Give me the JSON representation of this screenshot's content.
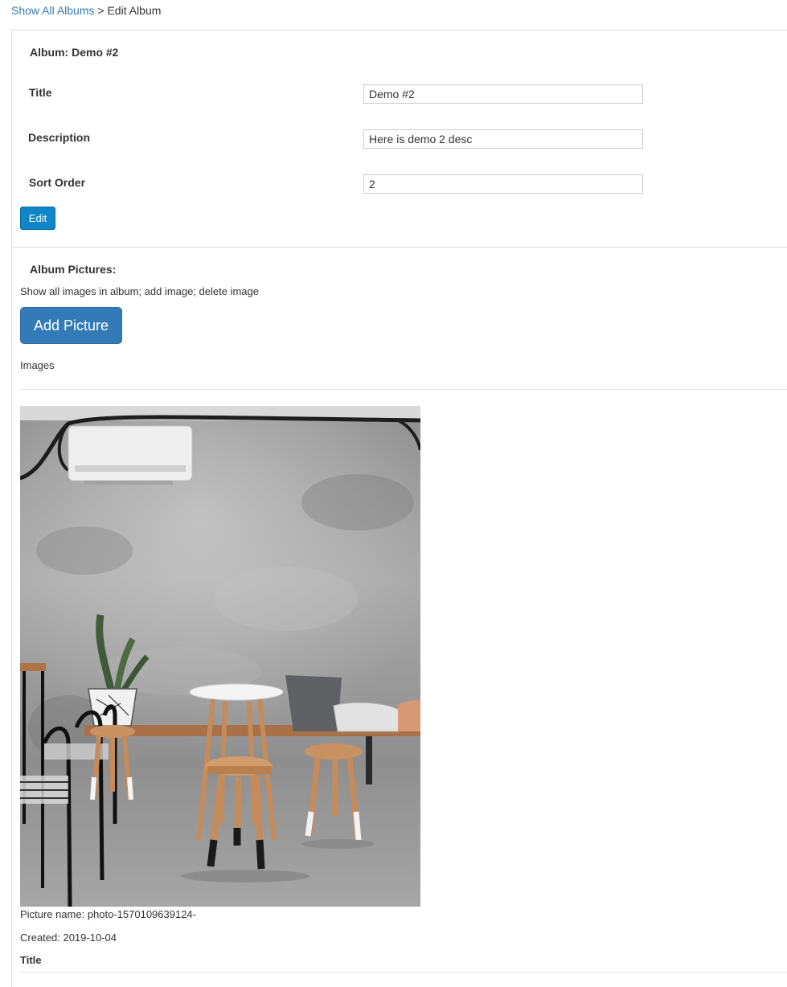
{
  "breadcrumb": {
    "link": "Show All Albums",
    "separator": " > ",
    "current": "Edit Album"
  },
  "album_form": {
    "heading": "Album: Demo #2",
    "title_label": "Title",
    "title_value": "Demo #2",
    "description_label": "Description",
    "description_value": "Here is demo 2 desc",
    "sort_label": "Sort Order",
    "sort_value": "2",
    "edit_button": "Edit"
  },
  "pictures": {
    "heading": "Album Pictures:",
    "help_text": "Show all images in album; add image; delete image",
    "add_button": "Add Picture",
    "images_label": "Images",
    "items": [
      {
        "name_line": "Picture name: photo-1570109639124-",
        "created_line": "Created: 2019-10-04",
        "title_label": "Title"
      }
    ]
  },
  "colors": {
    "link": "#337ab7",
    "edit_button": "#0e86c8",
    "add_button": "#337ab7"
  }
}
